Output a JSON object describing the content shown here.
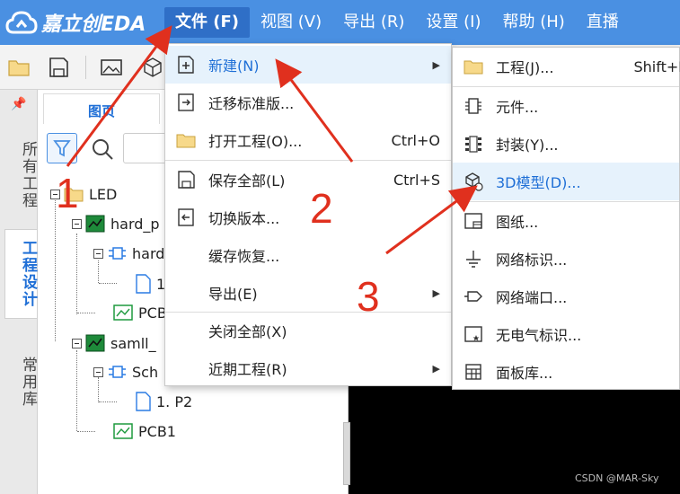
{
  "app": {
    "logo_text": "嘉立创EDA"
  },
  "menubar": {
    "items": [
      {
        "label": "文件 (F)"
      },
      {
        "label": "视图 (V)"
      },
      {
        "label": "导出 (R)"
      },
      {
        "label": "设置 (I)"
      },
      {
        "label": "帮助 (H)"
      },
      {
        "label": "直播"
      }
    ]
  },
  "sidebar": {
    "pin": "📌",
    "tabs": [
      {
        "label": "所有工程"
      },
      {
        "label": "工程设计"
      },
      {
        "label": "常用库"
      }
    ]
  },
  "panel": {
    "tab_label": "图页",
    "tree": [
      {
        "label": "LED"
      },
      {
        "label": "hard_p"
      },
      {
        "label": "hard"
      },
      {
        "label": "1."
      },
      {
        "label": "PCB"
      },
      {
        "label": "samll_"
      },
      {
        "label": "Sch"
      },
      {
        "label": "1. P2"
      },
      {
        "label": "PCB1"
      }
    ]
  },
  "file_menu": {
    "items": [
      {
        "label": "新建(N)",
        "shortcut": ""
      },
      {
        "label": "迁移标准版...",
        "shortcut": ""
      },
      {
        "label": "打开工程(O)...",
        "shortcut": "Ctrl+O"
      },
      {
        "label": "保存全部(L)",
        "shortcut": "Ctrl+S"
      },
      {
        "label": "切换版本...",
        "shortcut": ""
      },
      {
        "label": "缓存恢复...",
        "shortcut": ""
      },
      {
        "label": "导出(E)",
        "shortcut": ""
      },
      {
        "label": "关闭全部(X)",
        "shortcut": ""
      },
      {
        "label": "近期工程(R)",
        "shortcut": ""
      }
    ]
  },
  "new_submenu": {
    "items": [
      {
        "label": "工程(J)...",
        "shortcut": "Shift+I"
      },
      {
        "label": "元件..."
      },
      {
        "label": "封装(Y)..."
      },
      {
        "label": "3D模型(D)..."
      },
      {
        "label": "图纸..."
      },
      {
        "label": "网络标识..."
      },
      {
        "label": "网络端口..."
      },
      {
        "label": "无电气标识..."
      },
      {
        "label": "面板库..."
      }
    ]
  },
  "annotations": {
    "n1": "1",
    "n2": "2",
    "n3": "3"
  },
  "watermark": "CSDN @MAR-Sky",
  "colors": {
    "topbar": "#4a90e2",
    "accent": "#1f6fd6",
    "annotation": "#e0301e"
  }
}
